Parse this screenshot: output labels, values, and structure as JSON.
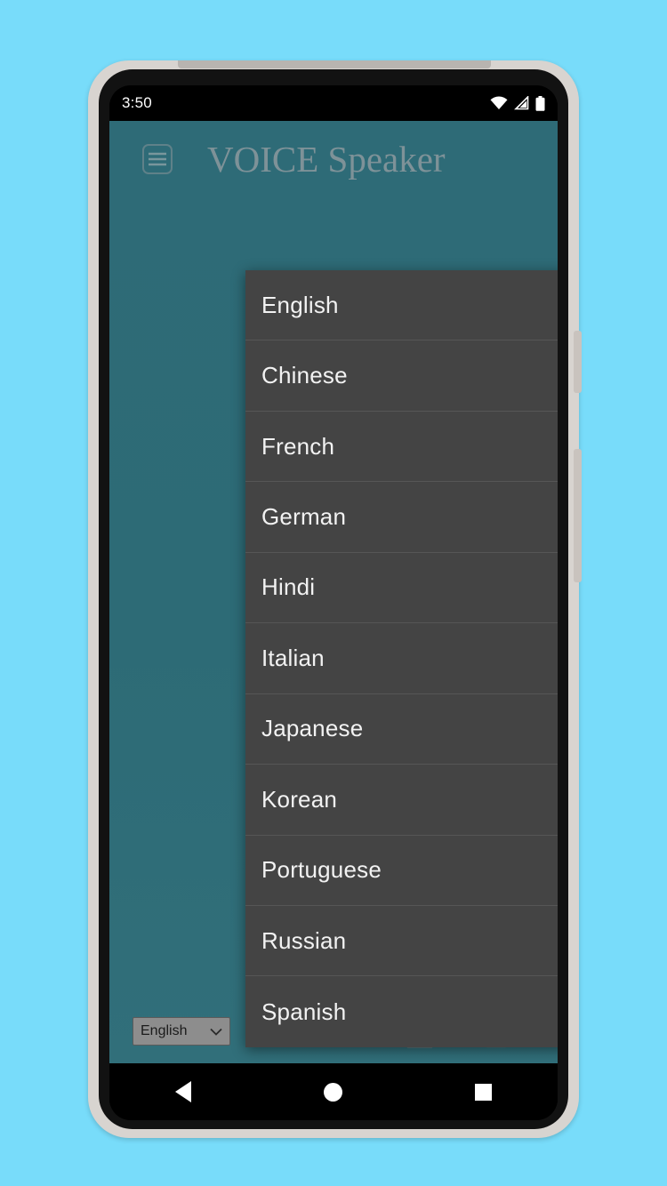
{
  "device": {
    "frame_color": "#D8D4D0",
    "screen_bg": "#000000",
    "page_bg": "#78DCFA"
  },
  "status_bar": {
    "time": "3:50",
    "icons": [
      "wifi-icon",
      "cellular-signal-icon",
      "battery-icon"
    ]
  },
  "app": {
    "title": "VOICE Speaker",
    "menu_icon": "hamburger-menu-icon",
    "accent_color": "#6FCCC0",
    "header_bg": "#2E6B77"
  },
  "dialog": {
    "name": "language-selection-dialog",
    "selected_value": "English",
    "bg_color": "#444444",
    "options": [
      {
        "label": "English",
        "selected": true
      },
      {
        "label": "Chinese",
        "selected": false
      },
      {
        "label": "French",
        "selected": false
      },
      {
        "label": "German",
        "selected": false
      },
      {
        "label": "Hindi",
        "selected": false
      },
      {
        "label": "Italian",
        "selected": false
      },
      {
        "label": "Japanese",
        "selected": false
      },
      {
        "label": "Korean",
        "selected": false
      },
      {
        "label": "Portuguese",
        "selected": false
      },
      {
        "label": "Russian",
        "selected": false
      },
      {
        "label": "Spanish",
        "selected": false
      }
    ]
  },
  "toolbar": {
    "language_select_value": "English",
    "language_select_chevron": "chevron-down-icon",
    "buttons": [
      {
        "name": "play-button",
        "icon": "play-icon"
      },
      {
        "name": "stop-button",
        "icon": "stop-icon"
      },
      {
        "name": "edit-button",
        "icon": "edit-note-icon"
      },
      {
        "name": "delete-button",
        "icon": "trash-icon"
      }
    ]
  },
  "nav_bar": {
    "back": "back-triangle-icon",
    "home": "home-circle-icon",
    "recents": "recents-square-icon"
  }
}
